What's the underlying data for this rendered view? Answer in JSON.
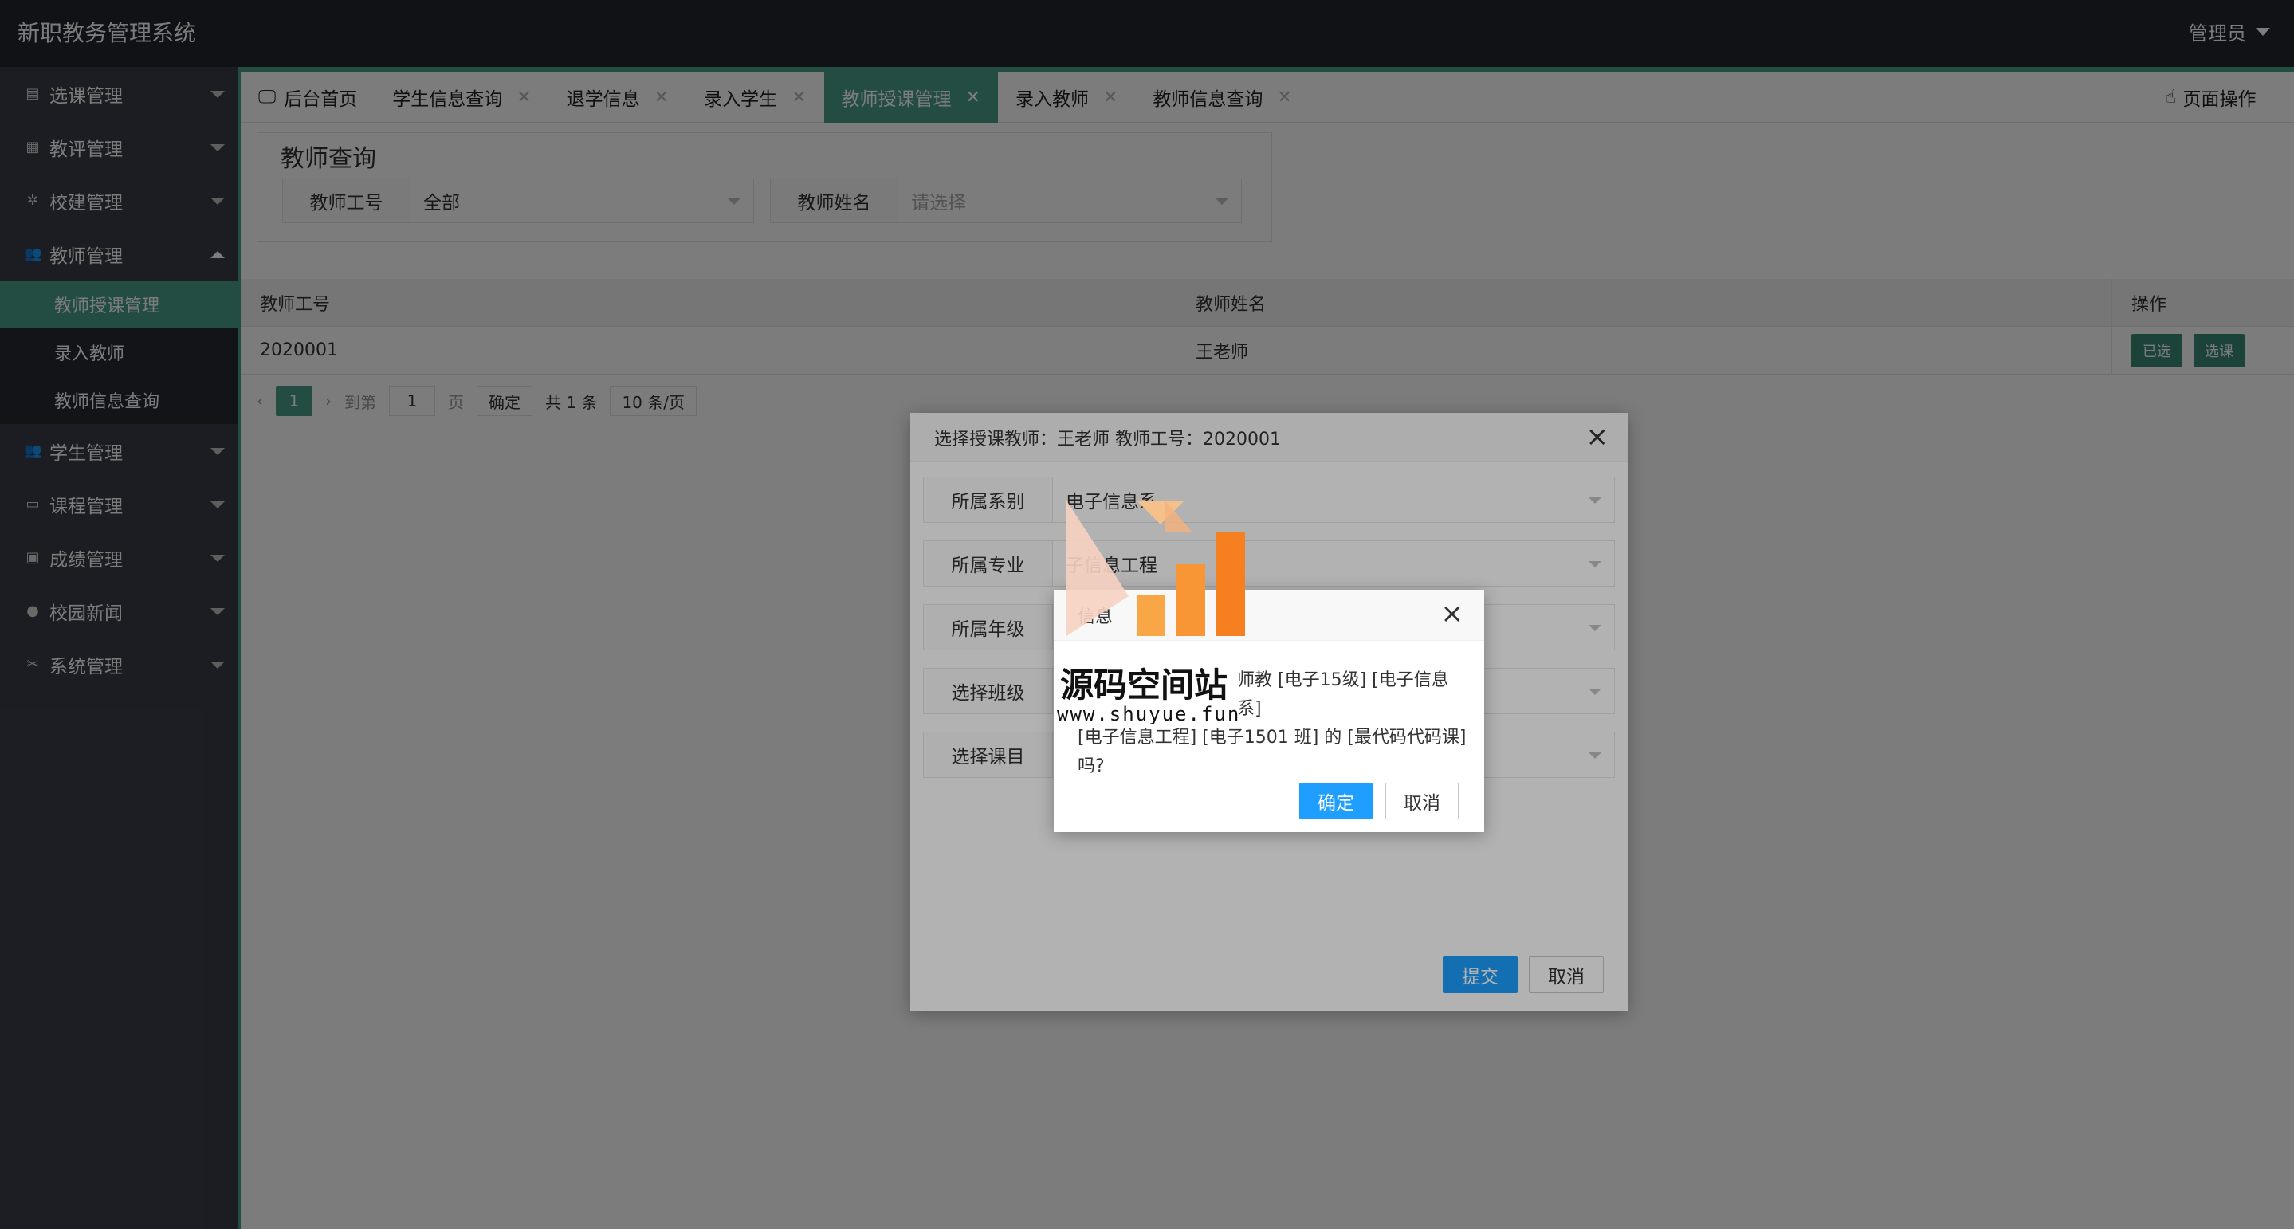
{
  "header": {
    "title": "新职教务管理系统",
    "user": "管理员"
  },
  "sidebar": {
    "items": [
      {
        "label": "选课管理",
        "icon": "file-icon"
      },
      {
        "label": "教评管理",
        "icon": "grid-icon"
      },
      {
        "label": "校建管理",
        "icon": "tree-icon"
      },
      {
        "label": "教师管理",
        "icon": "users-icon",
        "expanded": true
      },
      {
        "label": "学生管理",
        "icon": "users-icon"
      },
      {
        "label": "课程管理",
        "icon": "book-icon"
      },
      {
        "label": "成绩管理",
        "icon": "clipboard-icon"
      },
      {
        "label": "校园新闻",
        "icon": "chat-icon"
      },
      {
        "label": "系统管理",
        "icon": "tools-icon"
      }
    ],
    "teacher_sub": [
      {
        "label": "教师授课管理",
        "active": true
      },
      {
        "label": "录入教师"
      },
      {
        "label": "教师信息查询"
      }
    ]
  },
  "tabs": [
    {
      "label": "后台首页"
    },
    {
      "label": "学生信息查询"
    },
    {
      "label": "退学信息"
    },
    {
      "label": "录入学生"
    },
    {
      "label": "教师授课管理",
      "active": true
    },
    {
      "label": "录入教师"
    },
    {
      "label": "教师信息查询"
    }
  ],
  "page_ops": "页面操作",
  "search": {
    "legend": "教师查询",
    "id_label": "教师工号",
    "id_value": "全部",
    "name_label": "教师姓名",
    "name_placeholder": "请选择"
  },
  "table": {
    "headers": [
      "教师工号",
      "教师姓名",
      "操作"
    ],
    "rows": [
      {
        "id": "2020001",
        "name": "王老师",
        "btn1": "已选",
        "btn2": "选课"
      }
    ]
  },
  "pager": {
    "current": "1",
    "goto_prefix": "到第",
    "goto_value": "1",
    "goto_suffix": "页",
    "confirm": "确定",
    "total": "共 1 条",
    "per_page": "10 条/页"
  },
  "modal": {
    "title": "选择授课教师：王老师 教师工号：2020001",
    "fields": [
      {
        "label": "所属系别",
        "value": "电子信息系"
      },
      {
        "label": "所属专业",
        "value": "子信息工程"
      },
      {
        "label": "所属年级",
        "value": ""
      },
      {
        "label": "选择班级",
        "value": ""
      },
      {
        "label": "选择课目",
        "value": ""
      }
    ],
    "submit": "提交",
    "cancel": "取消"
  },
  "dialog": {
    "title": "信息",
    "message_line1": "师教 [电子15级] [电子信息系]",
    "message_line2": "[电子信息工程] [电子1501 班] 的 [最代码代码课]",
    "message_line3": "吗?",
    "ok": "确定",
    "cancel": "取消"
  },
  "watermark": {
    "text": "源码空间站",
    "url": "www.shuyue.fun"
  },
  "colors": {
    "accent": "#4aa08a",
    "header": "#23262e",
    "sidebar": "#393d49",
    "primary_btn": "#1e9fff"
  }
}
